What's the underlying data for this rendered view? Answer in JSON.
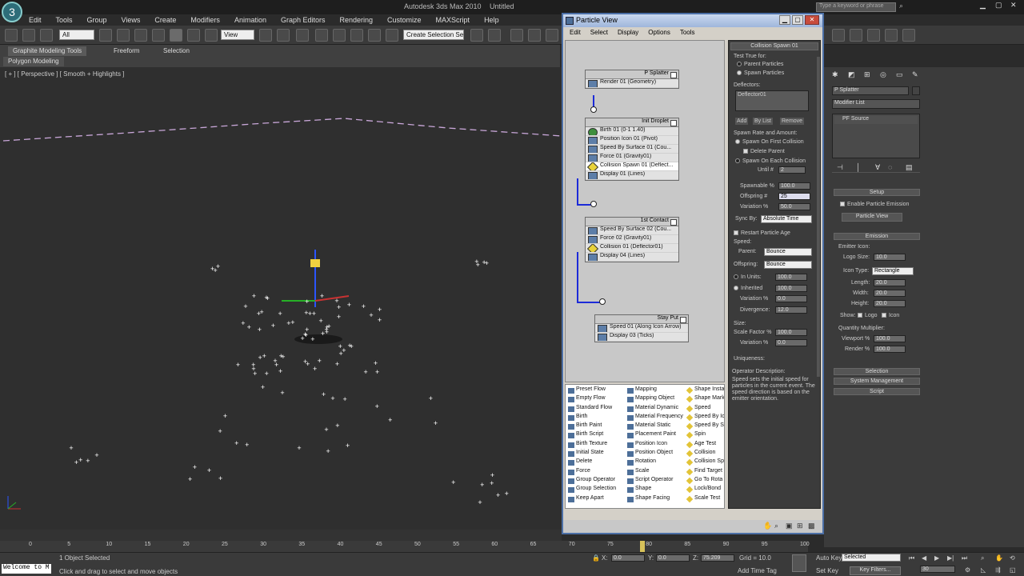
{
  "app": {
    "title": "Autodesk 3ds Max 2010",
    "file": "Untitled",
    "search_placeholder": "Type a keyword or phrase"
  },
  "menu": [
    "Edit",
    "Tools",
    "Group",
    "Views",
    "Create",
    "Modifiers",
    "Animation",
    "Graph Editors",
    "Rendering",
    "Customize",
    "MAXScript",
    "Help"
  ],
  "toolbar": {
    "filter": "All",
    "view": "View",
    "named_sel": "Create Selection Se"
  },
  "ribbon": {
    "tabs": [
      "Graphite Modeling Tools",
      "Freeform",
      "Selection"
    ],
    "sub": "Polygon Modeling"
  },
  "viewport": {
    "label": "[ + ] [ Perspective ] [ Smooth + Highlights ]"
  },
  "pv": {
    "title": "Particle View",
    "menu": [
      "Edit",
      "Select",
      "Display",
      "Options",
      "Tools"
    ],
    "events": [
      {
        "name": "P Splatter",
        "ops": [
          {
            "t": "Render 01 (Geometry)",
            "k": ""
          }
        ]
      },
      {
        "name": "Init Droplet",
        "ops": [
          {
            "t": "Birth 01 (0-1 1.40)",
            "k": "grn"
          },
          {
            "t": "Position Icon 01 (Pivot)",
            "k": ""
          },
          {
            "t": "Speed By Surface 01 (Cou...",
            "k": ""
          },
          {
            "t": "Force 01 (Gravity01)",
            "k": ""
          },
          {
            "t": "Collision Spawn 01 (Deflect...",
            "k": "yel hi"
          },
          {
            "t": "Display 01 (Lines)",
            "k": ""
          }
        ]
      },
      {
        "name": "1st Contact",
        "ops": [
          {
            "t": "Speed By Surface 02 (Cou...",
            "k": ""
          },
          {
            "t": "Force 02 (Gravity01)",
            "k": ""
          },
          {
            "t": "Collision 01 (Deflector01)",
            "k": "yel"
          },
          {
            "t": "Display 04 (Lines)",
            "k": ""
          }
        ]
      },
      {
        "name": "Stay Put",
        "ops": [
          {
            "t": "Speed 01 (Along Icon Arrow)",
            "k": ""
          },
          {
            "t": "Display 03 (Ticks)",
            "k": ""
          }
        ]
      }
    ],
    "depot": [
      [
        "Preset Flow",
        "Empty Flow",
        "Standard Flow",
        "Birth",
        "Birth Paint",
        "Birth Script",
        "Birth Texture",
        "Initial State",
        "Delete",
        "Force",
        "Group Operator",
        "Group Selection",
        "Keep Apart"
      ],
      [
        "Mapping",
        "Mapping Object",
        "Material Dynamic",
        "Material Frequency",
        "Material Static",
        "Placement Paint",
        "Position Icon",
        "Position Object",
        "Rotation",
        "Scale",
        "Script Operator",
        "Shape",
        "Shape Facing"
      ],
      [
        "Shape Insta",
        "Shape Mark",
        "Speed",
        "Speed By Ic",
        "Speed By S",
        "Spin",
        "Age Test",
        "Collision",
        "Collision Sp",
        "Find Target",
        "Go To Rota",
        "Lock/Bond",
        "Scale Test"
      ]
    ],
    "params": {
      "rollout": "Collision Spawn 01",
      "test_true_for": "Test True for:",
      "parent_particles": "Parent Particles",
      "spawn_particles": "Spawn Particles",
      "deflectors": "Deflectors:",
      "deflector_item": "Deflector01",
      "add": "Add",
      "by_list": "By List",
      "remove": "Remove",
      "spawn_rate": "Spawn Rate and Amount:",
      "spawn_first": "Spawn On First Collision",
      "delete_parent": "Delete Parent",
      "spawn_each": "Spawn On Each Collision",
      "until": "Until #",
      "until_val": "2",
      "spawnable": "Spawnable %",
      "spawnable_val": "100.0",
      "offspring": "Offspring #",
      "offspring_val": "25",
      "variation": "Variation %",
      "variation_val": "50.0",
      "sync_by": "Sync By:",
      "sync_val": "Absolute Time",
      "restart_age": "Restart Particle Age",
      "speed": "Speed:",
      "parent": "Parent:",
      "parent_val": "Bounce",
      "offspring_lbl": "Offspring:",
      "offspring_dd": "Bounce",
      "in_units": "In Units:",
      "in_units_val": "100.0",
      "inherited": "Inherited",
      "inherited_val": "100.0",
      "variation2": "Variation %",
      "variation2_val": "0.0",
      "divergence": "Divergence:",
      "divergence_val": "12.0",
      "size": "Size:",
      "scale_factor": "Scale Factor %",
      "scale_factor_val": "100.0",
      "variation3": "Variation %",
      "variation3_val": "0.0",
      "uniqueness": "Uniqueness:"
    },
    "desc": {
      "title": "Operator Description:",
      "text": "Speed sets the initial speed for particles in the current event. The speed direction is based on the emitter orientation."
    }
  },
  "cmd": {
    "object_name": "P Splatter",
    "modifier_list": "Modifier List",
    "stack_item": "PF Source",
    "setup": "Setup",
    "enable_emission": "Enable Particle Emission",
    "particle_view": "Particle View",
    "emission": "Emission",
    "emitter_icon": "Emitter Icon:",
    "logo_size": "Logo Size:",
    "logo_size_val": "10.0",
    "icon_type": "Icon Type:",
    "icon_type_val": "Rectangle",
    "length": "Length:",
    "length_val": "20.0",
    "width": "Width:",
    "width_val": "20.0",
    "height": "Height:",
    "height_val": "20.0",
    "show": "Show:",
    "logo": "Logo",
    "icon": "Icon",
    "quantity": "Quantity Multiplier:",
    "viewport": "Viewport %",
    "viewport_val": "100.0",
    "render": "Render %",
    "render_val": "100.0",
    "selection": "Selection",
    "system_management": "System Management",
    "script": "Script"
  },
  "timeline": {
    "ticks": [
      "0",
      "5",
      "10",
      "15",
      "20",
      "25",
      "30",
      "35",
      "40",
      "45",
      "50",
      "55",
      "60",
      "65",
      "70",
      "75",
      "80",
      "85",
      "90",
      "95",
      "100"
    ]
  },
  "status": {
    "listener": "Welcome to M",
    "selected": "1 Object Selected",
    "prompt": "Click and drag to select and move objects",
    "x": "0.0",
    "y": "0.0",
    "z": "75.209",
    "grid": "Grid = 10.0",
    "auto_key": "Auto Key",
    "set_key": "Set Key",
    "key_mode": "Selected",
    "key_filters": "Key Filters...",
    "add_time_tag": "Add Time Tag",
    "frame": "30"
  }
}
